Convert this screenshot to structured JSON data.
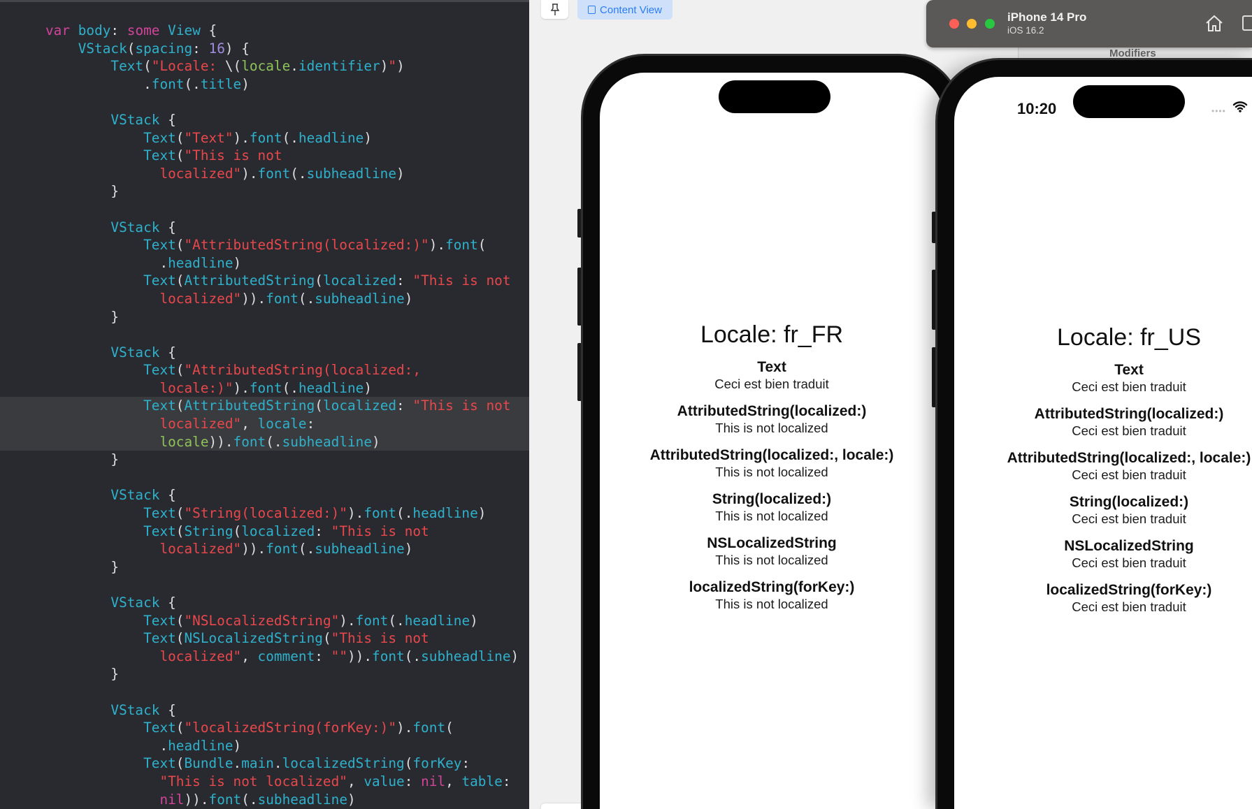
{
  "editor": {
    "lines": [
      [
        [
          "k",
          "var"
        ],
        [
          "p",
          " "
        ],
        [
          "t",
          "body"
        ],
        [
          "p",
          ": "
        ],
        [
          "k",
          "some"
        ],
        [
          "p",
          " "
        ],
        [
          "t",
          "View"
        ],
        [
          "p",
          " {"
        ]
      ],
      [
        [
          "p",
          "    "
        ],
        [
          "t",
          "VStack"
        ],
        [
          "p",
          "("
        ],
        [
          "t",
          "spacing"
        ],
        [
          "p",
          ": "
        ],
        [
          "n",
          "16"
        ],
        [
          "p",
          ") {"
        ]
      ],
      [
        [
          "p",
          "        "
        ],
        [
          "t",
          "Text"
        ],
        [
          "p",
          "("
        ],
        [
          "s",
          "\"Locale: "
        ],
        [
          "p",
          "\\("
        ],
        [
          "v",
          "locale"
        ],
        [
          "p",
          "."
        ],
        [
          "t",
          "identifier"
        ],
        [
          "p",
          ")"
        ],
        [
          "s",
          "\""
        ],
        [
          "p",
          ")"
        ]
      ],
      [
        [
          "p",
          "            ."
        ],
        [
          "t",
          "font"
        ],
        [
          "p",
          "(."
        ],
        [
          "t",
          "title"
        ],
        [
          "p",
          ")"
        ]
      ],
      [],
      [
        [
          "p",
          "        "
        ],
        [
          "t",
          "VStack"
        ],
        [
          "p",
          " {"
        ]
      ],
      [
        [
          "p",
          "            "
        ],
        [
          "t",
          "Text"
        ],
        [
          "p",
          "("
        ],
        [
          "s",
          "\"Text\""
        ],
        [
          "p",
          ")."
        ],
        [
          "t",
          "font"
        ],
        [
          "p",
          "(."
        ],
        [
          "t",
          "headline"
        ],
        [
          "p",
          ")"
        ]
      ],
      [
        [
          "p",
          "            "
        ],
        [
          "t",
          "Text"
        ],
        [
          "p",
          "("
        ],
        [
          "s",
          "\"This is not"
        ]
      ],
      [
        [
          "s",
          "              localized\""
        ],
        [
          "p",
          ")."
        ],
        [
          "t",
          "font"
        ],
        [
          "p",
          "(."
        ],
        [
          "t",
          "subheadline"
        ],
        [
          "p",
          ")"
        ]
      ],
      [
        [
          "p",
          "        }"
        ]
      ],
      [],
      [
        [
          "p",
          "        "
        ],
        [
          "t",
          "VStack"
        ],
        [
          "p",
          " {"
        ]
      ],
      [
        [
          "p",
          "            "
        ],
        [
          "t",
          "Text"
        ],
        [
          "p",
          "("
        ],
        [
          "s",
          "\"AttributedString(localized:)\""
        ],
        [
          "p",
          ")."
        ],
        [
          "t",
          "font"
        ],
        [
          "p",
          "("
        ]
      ],
      [
        [
          "p",
          "              ."
        ],
        [
          "t",
          "headline"
        ],
        [
          "p",
          ")"
        ]
      ],
      [
        [
          "p",
          "            "
        ],
        [
          "t",
          "Text"
        ],
        [
          "p",
          "("
        ],
        [
          "t",
          "AttributedString"
        ],
        [
          "p",
          "("
        ],
        [
          "t",
          "localized"
        ],
        [
          "p",
          ": "
        ],
        [
          "s",
          "\"This is not"
        ]
      ],
      [
        [
          "s",
          "              localized\""
        ],
        [
          "p",
          "))."
        ],
        [
          "t",
          "font"
        ],
        [
          "p",
          "(."
        ],
        [
          "t",
          "subheadline"
        ],
        [
          "p",
          ")"
        ]
      ],
      [
        [
          "p",
          "        }"
        ]
      ],
      [],
      [
        [
          "p",
          "        "
        ],
        [
          "t",
          "VStack"
        ],
        [
          "p",
          " {"
        ]
      ],
      [
        [
          "p",
          "            "
        ],
        [
          "t",
          "Text"
        ],
        [
          "p",
          "("
        ],
        [
          "s",
          "\"AttributedString(localized:,"
        ]
      ],
      [
        [
          "s",
          "              locale:)\""
        ],
        [
          "p",
          ")."
        ],
        [
          "t",
          "font"
        ],
        [
          "p",
          "(."
        ],
        [
          "t",
          "headline"
        ],
        [
          "p",
          ")"
        ]
      ],
      [
        [
          "p",
          "            "
        ],
        [
          "t",
          "Text"
        ],
        [
          "p",
          "("
        ],
        [
          "t",
          "AttributedString"
        ],
        [
          "p",
          "("
        ],
        [
          "t",
          "localized"
        ],
        [
          "p",
          ": "
        ],
        [
          "s",
          "\"This is not"
        ]
      ],
      [
        [
          "s",
          "              localized\""
        ],
        [
          "p",
          ", "
        ],
        [
          "t",
          "locale"
        ],
        [
          "p",
          ":"
        ]
      ],
      [
        [
          "p",
          "              "
        ],
        [
          "v",
          "locale"
        ],
        [
          "p",
          "))."
        ],
        [
          "t",
          "font"
        ],
        [
          "p",
          "(."
        ],
        [
          "t",
          "subheadline"
        ],
        [
          "p",
          ")"
        ]
      ],
      [
        [
          "p",
          "        }"
        ]
      ],
      [],
      [
        [
          "p",
          "        "
        ],
        [
          "t",
          "VStack"
        ],
        [
          "p",
          " {"
        ]
      ],
      [
        [
          "p",
          "            "
        ],
        [
          "t",
          "Text"
        ],
        [
          "p",
          "("
        ],
        [
          "s",
          "\"String(localized:)\""
        ],
        [
          "p",
          ")."
        ],
        [
          "t",
          "font"
        ],
        [
          "p",
          "(."
        ],
        [
          "t",
          "headline"
        ],
        [
          "p",
          ")"
        ]
      ],
      [
        [
          "p",
          "            "
        ],
        [
          "t",
          "Text"
        ],
        [
          "p",
          "("
        ],
        [
          "t",
          "String"
        ],
        [
          "p",
          "("
        ],
        [
          "t",
          "localized"
        ],
        [
          "p",
          ": "
        ],
        [
          "s",
          "\"This is not"
        ]
      ],
      [
        [
          "s",
          "              localized\""
        ],
        [
          "p",
          "))."
        ],
        [
          "t",
          "font"
        ],
        [
          "p",
          "(."
        ],
        [
          "t",
          "subheadline"
        ],
        [
          "p",
          ")"
        ]
      ],
      [
        [
          "p",
          "        }"
        ]
      ],
      [],
      [
        [
          "p",
          "        "
        ],
        [
          "t",
          "VStack"
        ],
        [
          "p",
          " {"
        ]
      ],
      [
        [
          "p",
          "            "
        ],
        [
          "t",
          "Text"
        ],
        [
          "p",
          "("
        ],
        [
          "s",
          "\"NSLocalizedString\""
        ],
        [
          "p",
          ")."
        ],
        [
          "t",
          "font"
        ],
        [
          "p",
          "(."
        ],
        [
          "t",
          "headline"
        ],
        [
          "p",
          ")"
        ]
      ],
      [
        [
          "p",
          "            "
        ],
        [
          "t",
          "Text"
        ],
        [
          "p",
          "("
        ],
        [
          "t",
          "NSLocalizedString"
        ],
        [
          "p",
          "("
        ],
        [
          "s",
          "\"This is not"
        ]
      ],
      [
        [
          "s",
          "              localized\""
        ],
        [
          "p",
          ", "
        ],
        [
          "t",
          "comment"
        ],
        [
          "p",
          ": "
        ],
        [
          "s",
          "\"\""
        ],
        [
          "p",
          "))."
        ],
        [
          "t",
          "font"
        ],
        [
          "p",
          "(."
        ],
        [
          "t",
          "subheadline"
        ],
        [
          "p",
          ")"
        ]
      ],
      [
        [
          "p",
          "        }"
        ]
      ],
      [],
      [
        [
          "p",
          "        "
        ],
        [
          "t",
          "VStack"
        ],
        [
          "p",
          " {"
        ]
      ],
      [
        [
          "p",
          "            "
        ],
        [
          "t",
          "Text"
        ],
        [
          "p",
          "("
        ],
        [
          "s",
          "\"localizedString(forKey:)\""
        ],
        [
          "p",
          ")."
        ],
        [
          "t",
          "font"
        ],
        [
          "p",
          "("
        ]
      ],
      [
        [
          "p",
          "              ."
        ],
        [
          "t",
          "headline"
        ],
        [
          "p",
          ")"
        ]
      ],
      [
        [
          "p",
          "            "
        ],
        [
          "t",
          "Text"
        ],
        [
          "p",
          "("
        ],
        [
          "t",
          "Bundle"
        ],
        [
          "p",
          "."
        ],
        [
          "t",
          "main"
        ],
        [
          "p",
          "."
        ],
        [
          "t",
          "localizedString"
        ],
        [
          "p",
          "("
        ],
        [
          "t",
          "forKey"
        ],
        [
          "p",
          ":"
        ]
      ],
      [
        [
          "p",
          "              "
        ],
        [
          "s",
          "\"This is not localized\""
        ],
        [
          "p",
          ", "
        ],
        [
          "t",
          "value"
        ],
        [
          "p",
          ": "
        ],
        [
          "k",
          "nil"
        ],
        [
          "p",
          ", "
        ],
        [
          "t",
          "table"
        ],
        [
          "p",
          ":"
        ]
      ],
      [
        [
          "p",
          "              "
        ],
        [
          "k",
          "nil"
        ],
        [
          "p",
          "))."
        ],
        [
          "t",
          "font"
        ],
        [
          "p",
          "(."
        ],
        [
          "t",
          "subheadline"
        ],
        [
          "p",
          ")"
        ]
      ]
    ]
  },
  "canvas": {
    "pin_icon": "pin-icon",
    "content_view_label": "Content View",
    "modifiers_label": "Modifiers"
  },
  "simulator": {
    "device_name": "iPhone 14 Pro",
    "os_version": "iOS 16.2",
    "traffic_colors": [
      "#fe5f57",
      "#febc2e",
      "#28c840"
    ]
  },
  "phone1": {
    "title": "Locale: fr_FR",
    "groups": [
      {
        "headline": "Text",
        "sub": "Ceci est bien traduit"
      },
      {
        "headline": "AttributedString(localized:)",
        "sub": "This is not localized"
      },
      {
        "headline": "AttributedString(localized:, locale:)",
        "sub": "This is not localized"
      },
      {
        "headline": "String(localized:)",
        "sub": "This is not localized"
      },
      {
        "headline": "NSLocalizedString",
        "sub": "This is not localized"
      },
      {
        "headline": "localizedString(forKey:)",
        "sub": "This is not localized"
      }
    ]
  },
  "phone2": {
    "time": "10:20",
    "title": "Locale: fr_US",
    "groups": [
      {
        "headline": "Text",
        "sub": "Ceci est bien traduit"
      },
      {
        "headline": "AttributedString(localized:)",
        "sub": "Ceci est bien traduit"
      },
      {
        "headline": "AttributedString(localized:, locale:)",
        "sub": "Ceci est bien traduit"
      },
      {
        "headline": "String(localized:)",
        "sub": "Ceci est bien traduit"
      },
      {
        "headline": "NSLocalizedString",
        "sub": "Ceci est bien traduit"
      },
      {
        "headline": "localizedString(forKey:)",
        "sub": "Ceci est bien traduit"
      }
    ]
  }
}
